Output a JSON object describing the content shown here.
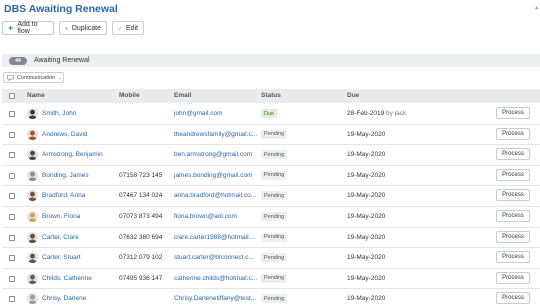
{
  "page": {
    "title": "DBS Awaiting Renewal"
  },
  "toolbar": {
    "add_label": "Add to flow",
    "duplicate_label": "Duplicate",
    "edit_label": "Edit"
  },
  "section": {
    "count": "44",
    "label": "Awaiting Renewal"
  },
  "filter": {
    "label": "Communication"
  },
  "table": {
    "headers": {
      "name": "Name",
      "mobile": "Mobile",
      "email": "Email",
      "status": "Status",
      "due": "Due"
    },
    "rows": [
      {
        "name": "Smith, John",
        "mobile": "",
        "email": "john@gmail.com",
        "status": "Due",
        "status_type": "due",
        "due_date": "28-Feb-2019",
        "due_by": "by jack",
        "action": "Process",
        "avatar_color": "#3a3a3a"
      },
      {
        "name": "Andrews, David",
        "mobile": "",
        "email": "theandrewsfamily@gmail.c...",
        "status": "Pending",
        "status_type": "pending",
        "due_date": "19-May-2020",
        "due_by": "",
        "action": "Process",
        "avatar_color": "#a0522d"
      },
      {
        "name": "Armstrong, Benjamin",
        "mobile": "",
        "email": "ben.armstrong@gmail.com",
        "status": "Pending",
        "status_type": "pending",
        "due_date": "19-May-2020",
        "due_by": "",
        "action": "Process",
        "avatar_color": "#4a4a4a"
      },
      {
        "name": "Bonding, James",
        "mobile": "07158 723 145",
        "email": "james.bonding@gmail.com",
        "status": "Pending",
        "status_type": "pending",
        "due_date": "19-May-2020",
        "due_by": "",
        "action": "Process",
        "avatar_color": "#8a8a8a"
      },
      {
        "name": "Bradford, Anna",
        "mobile": "07467 134 024",
        "email": "anna.bradford@hotmail.co...",
        "status": "Pending",
        "status_type": "pending",
        "due_date": "19-May-2020",
        "due_by": "",
        "action": "Process",
        "avatar_color": "#7b4a2a"
      },
      {
        "name": "Brown, Fiona",
        "mobile": "07073 873 494",
        "email": "fiona.brown@aol.com",
        "status": "Pending",
        "status_type": "pending",
        "due_date": "19-May-2020",
        "due_by": "",
        "action": "Process",
        "avatar_color": "#c9a15a"
      },
      {
        "name": "Carter, Clare",
        "mobile": "07632 380 694",
        "email": "clare.carter1988@hotmail....",
        "status": "Pending",
        "status_type": "pending",
        "due_date": "19-May-2020",
        "due_by": "",
        "action": "Process",
        "avatar_color": "#6b4a35"
      },
      {
        "name": "Carter, Stuart",
        "mobile": "07312 079 102",
        "email": "stuart.carter@btconnect.c...",
        "status": "Pending",
        "status_type": "pending",
        "due_date": "19-May-2020",
        "due_by": "",
        "action": "Process",
        "avatar_color": "#555555"
      },
      {
        "name": "Childs, Catherine",
        "mobile": "07495 936 147",
        "email": "catherine.childs@hotmail.c...",
        "status": "Pending",
        "status_type": "pending",
        "due_date": "19-May-2020",
        "due_by": "",
        "action": "Process",
        "avatar_color": "#5a5a5a"
      },
      {
        "name": "Chrisy, Darlene",
        "mobile": "",
        "email": "Chrisy.Darlenetiffany@test...",
        "status": "Pending",
        "status_type": "pending",
        "due_date": "19-May-2020",
        "due_by": "",
        "action": "Process",
        "avatar_color": "#9a9a9a"
      }
    ]
  },
  "colors": {
    "accent": "#2a67a8",
    "due_badge": "#dff1d8",
    "pending_badge": "#eceef0"
  },
  "icons": {
    "add": "plus-icon",
    "duplicate": "duplicate-icon",
    "edit": "pencil-icon",
    "filter": "comment-icon"
  }
}
